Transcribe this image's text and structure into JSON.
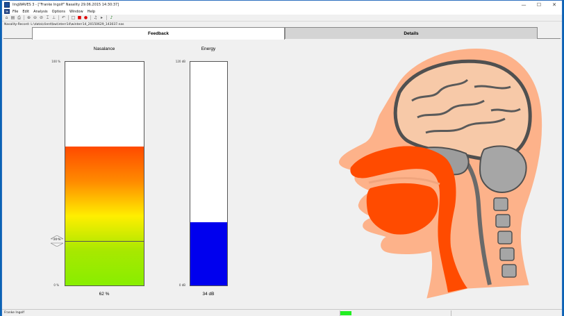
{
  "window": {
    "title": "lingWAVES 3 - [\"Franke Ingolf\" Nasality 29.06.2015 14:30:37]",
    "minimize_glyph": "—",
    "maximize_glyph": "☐",
    "close_glyph": "✕"
  },
  "menu": {
    "logo_text": "lw",
    "items": [
      "File",
      "Edit",
      "Analysis",
      "Options",
      "Window",
      "Help"
    ]
  },
  "toolbar": {
    "icons": [
      "home-icon",
      "save-icon",
      "print-icon",
      "zoom-in-icon",
      "zoom-out-icon",
      "zoom-fit-icon",
      "cursor-icon",
      "marker-icon",
      "undo-icon",
      "stop-icon",
      "record-icon",
      "play-icon",
      "speaker-icon",
      "forward-icon",
      "audio-device-icon"
    ],
    "glyphs": [
      "⌂",
      "▤",
      "⎙",
      "⊕",
      "⊖",
      "⊘",
      "⌶",
      "⊥",
      "↶",
      "□",
      "■",
      "●",
      "♫",
      "▸",
      "♪"
    ]
  },
  "pathbar": {
    "text": "Nasality-Record: L:\\data\\client\\bw\\interr14\\winterr14_20150629_143037.nas"
  },
  "tabs": [
    {
      "label": "Feedback",
      "active": true
    },
    {
      "label": "Details",
      "active": false
    }
  ],
  "nasalance": {
    "title": "Nasalance",
    "axis_top": "100 %",
    "axis_bottom": "0 %",
    "value": 62,
    "value_text": "62 %",
    "threshold": 20,
    "threshold_text": "20 %",
    "gradient": [
      "#ff4a00",
      "#ff8a00",
      "#ffee00",
      "#a8e800",
      "#88ee00"
    ]
  },
  "energy": {
    "title": "Energy",
    "axis_top": "120 dB",
    "axis_bottom": "0 dB",
    "value": 34,
    "max": 120,
    "value_text": "34 dB",
    "color": "#0000ee"
  },
  "colors": {
    "skin": "#fdb28a",
    "tissue_dark": "#555555",
    "tissue_mid": "#a6a6a6",
    "airway": "#ff4b00"
  },
  "status": {
    "user": "Franke Ingolf",
    "indicator_color": "#22ee22"
  }
}
